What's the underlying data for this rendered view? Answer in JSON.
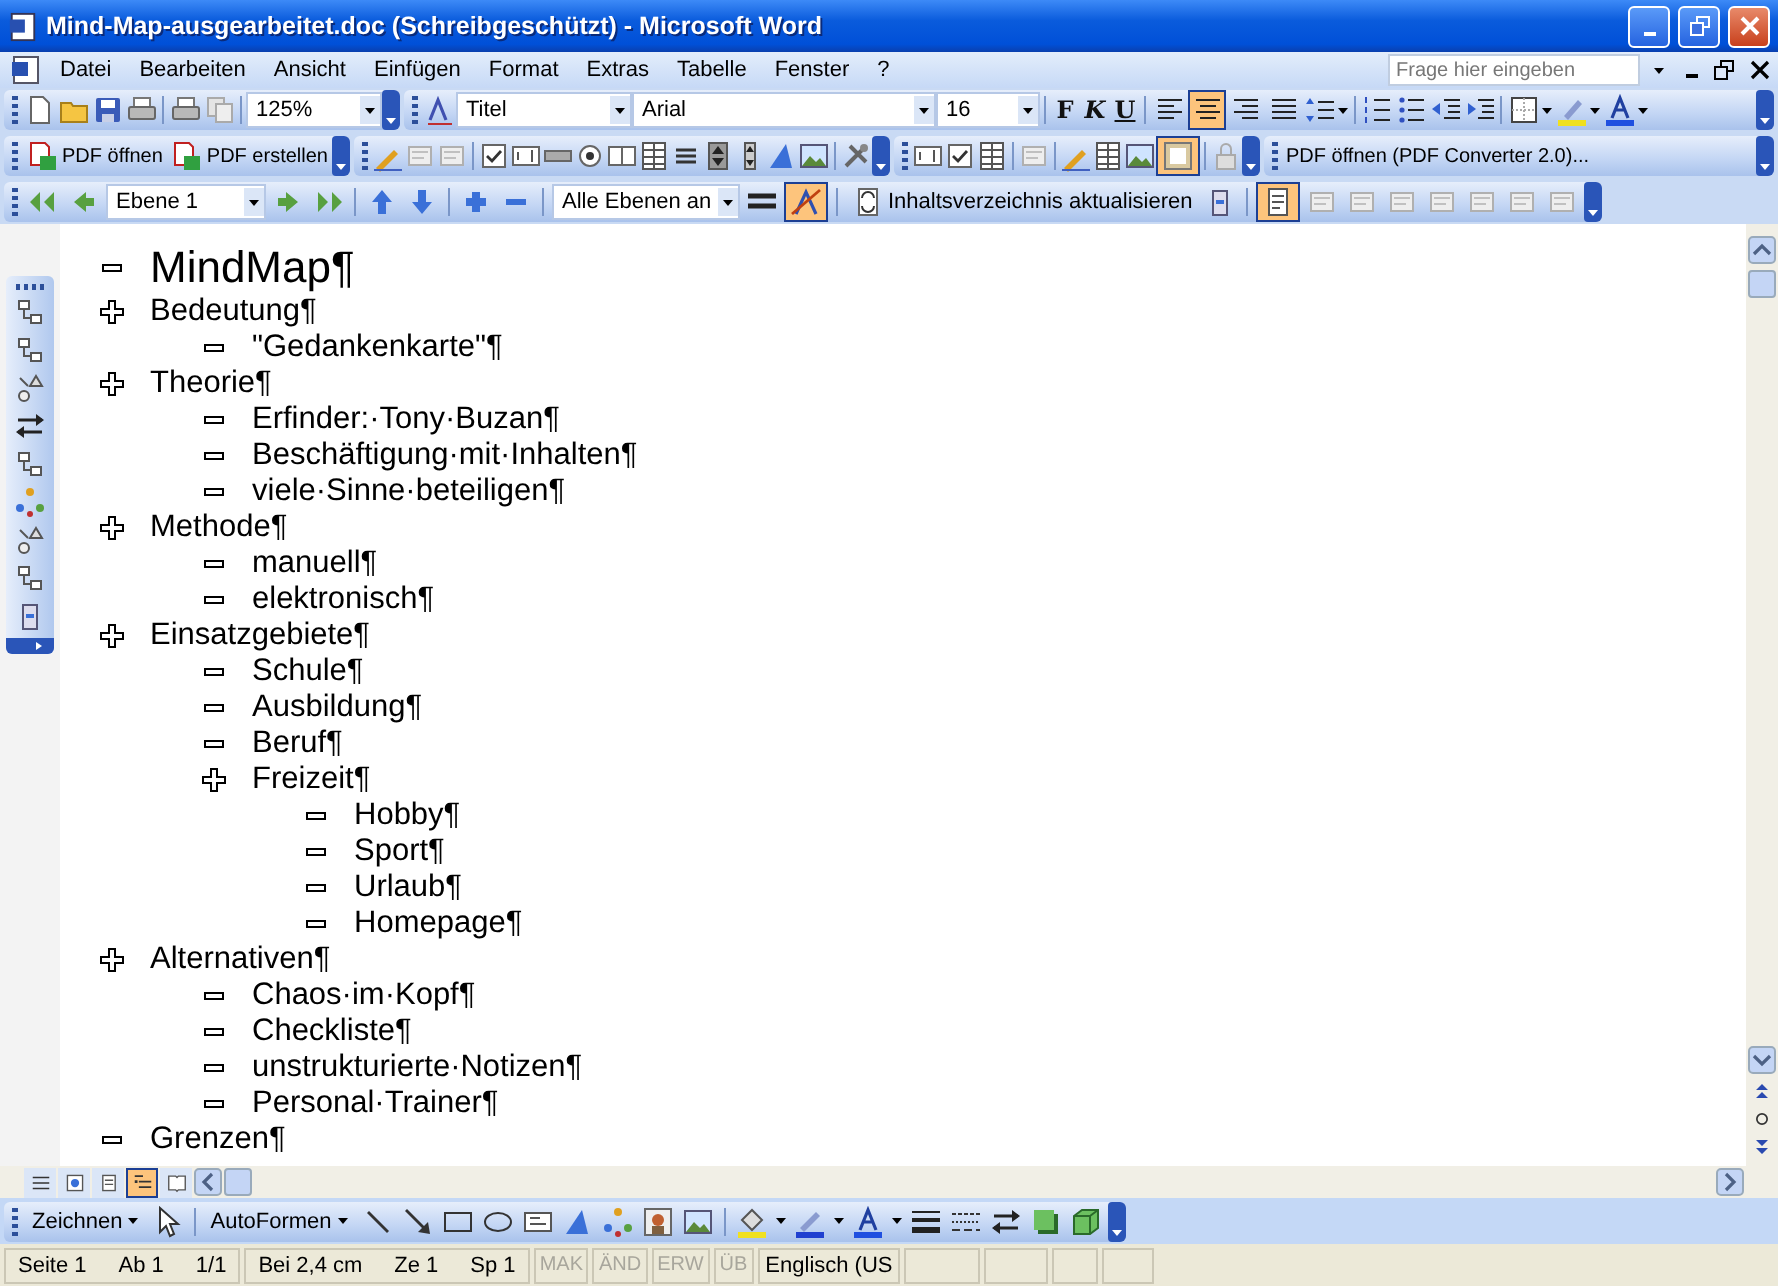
{
  "window": {
    "title": "Mind-Map-ausgearbeitet.doc (Schreibgeschützt) - Microsoft Word"
  },
  "menu": [
    "Datei",
    "Bearbeiten",
    "Ansicht",
    "Einfügen",
    "Format",
    "Extras",
    "Tabelle",
    "Fenster",
    "?"
  ],
  "help_field": {
    "placeholder": "Frage hier eingeben"
  },
  "standard_toolbar": {
    "zoom": "125%"
  },
  "formatting_toolbar": {
    "style": "Titel",
    "font": "Arial",
    "size": "16",
    "bold_label": "F",
    "italic_label": "K",
    "underline_label": "U",
    "alignment": [
      {
        "selected": false
      },
      {
        "selected": true
      },
      {
        "selected": false
      },
      {
        "selected": false
      }
    ]
  },
  "pdf_toolbar": {
    "buttons": [
      "PDF öffnen",
      "PDF erstellen"
    ]
  },
  "forms_toolbar": {
    "shading_on": true
  },
  "converter_toolbar": {
    "button": "PDF öffnen (PDF Converter 2.0)..."
  },
  "outline_toolbar": {
    "level": "Ebene 1",
    "show_levels": "Alle Ebenen an",
    "show_formatting_on": true,
    "toc_button": "Inhaltsverzeichnis aktualisieren",
    "master_view_on": true
  },
  "outline": [
    {
      "text": "MindMap¶",
      "kind": "title"
    },
    {
      "text": "Bedeutung¶",
      "kind": "heading",
      "children": [
        {
          "text": "\"Gedankenkarte\"¶",
          "kind": "heading"
        }
      ]
    },
    {
      "text": "Theorie¶",
      "kind": "heading",
      "children": [
        {
          "text": "Erfinder:·Tony·Buzan¶",
          "kind": "heading"
        },
        {
          "text": "Beschäftigung·mit·Inhalten¶",
          "kind": "heading"
        },
        {
          "text": "viele·Sinne·beteiligen¶",
          "kind": "heading"
        }
      ]
    },
    {
      "text": "Methode¶",
      "kind": "heading",
      "children": [
        {
          "text": "manuell¶",
          "kind": "heading"
        },
        {
          "text": "elektronisch¶",
          "kind": "heading"
        }
      ]
    },
    {
      "text": "Einsatzgebiete¶",
      "kind": "heading",
      "children": [
        {
          "text": "Schule¶",
          "kind": "heading"
        },
        {
          "text": "Ausbildung¶",
          "kind": "heading"
        },
        {
          "text": "Beruf¶",
          "kind": "heading"
        },
        {
          "text": "Freizeit¶",
          "kind": "heading",
          "children": [
            {
              "text": "Hobby¶",
              "kind": "heading"
            },
            {
              "text": "Sport¶",
              "kind": "heading"
            },
            {
              "text": "Urlaub¶",
              "kind": "heading"
            },
            {
              "text": "Homepage¶",
              "kind": "heading"
            }
          ]
        }
      ]
    },
    {
      "text": "Alternativen¶",
      "kind": "heading",
      "children": [
        {
          "text": "Chaos·im·Kopf¶",
          "kind": "heading"
        },
        {
          "text": "Checkliste¶",
          "kind": "heading"
        },
        {
          "text": "unstrukturierte·Notizen¶",
          "kind": "heading"
        },
        {
          "text": "Personal·Trainer¶",
          "kind": "heading"
        }
      ]
    },
    {
      "text": "Grenzen¶",
      "kind": "heading"
    }
  ],
  "view_buttons": [
    {
      "selected": false
    },
    {
      "selected": false
    },
    {
      "selected": false
    },
    {
      "selected": true
    },
    {
      "selected": false
    }
  ],
  "drawing_toolbar": {
    "draw_menu": "Zeichnen",
    "autoshapes_menu": "AutoFormen"
  },
  "status_bar": {
    "fields": [
      {
        "text": "Seite 1"
      },
      {
        "text": "Ab 1"
      },
      {
        "text": "1/1"
      },
      {
        "text": "Bei 2,4 cm"
      },
      {
        "text": "Ze 1"
      },
      {
        "text": "Sp 1"
      }
    ],
    "modes": [
      {
        "text": "MAK",
        "active": false
      },
      {
        "text": "ÄND",
        "active": false
      },
      {
        "text": "ERW",
        "active": false
      },
      {
        "text": "ÜB",
        "active": false
      }
    ],
    "language": "Englisch (US"
  }
}
